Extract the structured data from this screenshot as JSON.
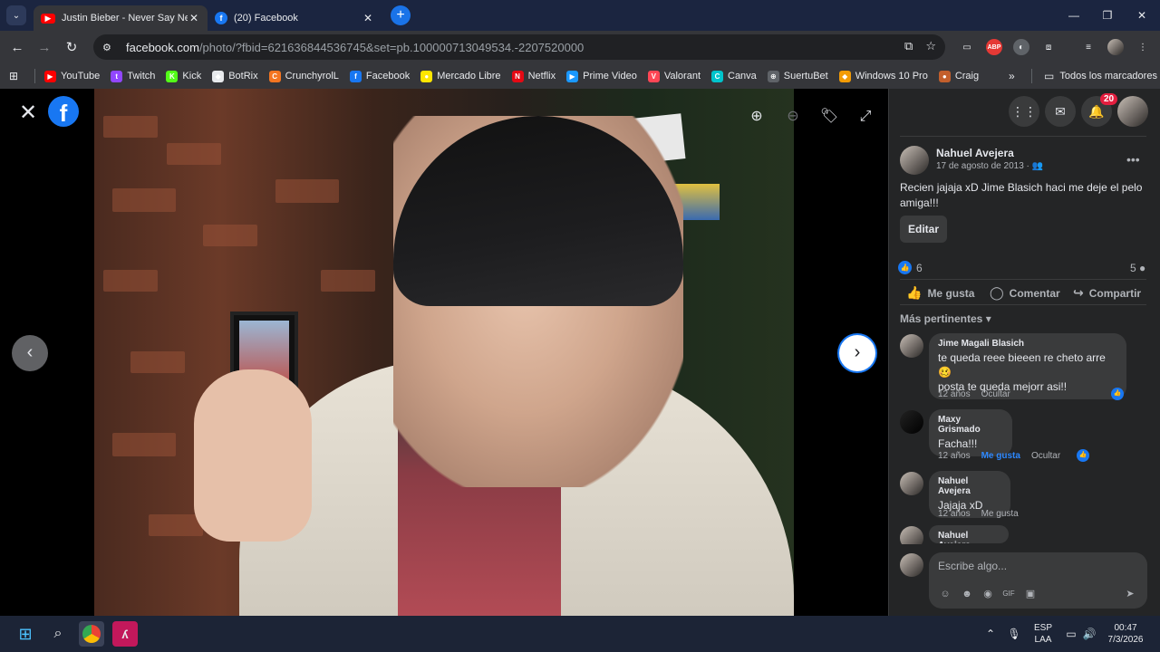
{
  "browser": {
    "tabs": [
      {
        "title": "Justin Bieber - Never Say Never",
        "icon": "youtube-icon",
        "active": true
      },
      {
        "title": "(20) Facebook",
        "icon": "facebook-icon",
        "active": false
      }
    ],
    "url_host": "facebook.com",
    "url_path": "/photo/?fbid=621636844536745&set=pb.100000713049534.-2207520000",
    "bookmarks": [
      {
        "label": "YouTube",
        "color": "#ff0000",
        "glyph": "▶"
      },
      {
        "label": "Twitch",
        "color": "#9146ff",
        "glyph": "t"
      },
      {
        "label": "Kick",
        "color": "#53fc18",
        "glyph": "K"
      },
      {
        "label": "BotRix",
        "color": "#e8eaed",
        "glyph": "◆"
      },
      {
        "label": "CrunchyrolL",
        "color": "#f47521",
        "glyph": "C"
      },
      {
        "label": "Facebook",
        "color": "#1877f2",
        "glyph": "f"
      },
      {
        "label": "Mercado Libre",
        "color": "#ffe600",
        "glyph": "●"
      },
      {
        "label": "Netflix",
        "color": "#e50914",
        "glyph": "N"
      },
      {
        "label": "Prime Video",
        "color": "#1a98ff",
        "glyph": "▶"
      },
      {
        "label": "Valorant",
        "color": "#ff4655",
        "glyph": "V"
      },
      {
        "label": "Canva",
        "color": "#00c4cc",
        "glyph": "C"
      },
      {
        "label": "SuertuBet",
        "color": "#5f6368",
        "glyph": "⊕"
      },
      {
        "label": "Windows 10 Pro",
        "color": "#f29b05",
        "glyph": "◆"
      },
      {
        "label": "Craig",
        "color": "#c35f2c",
        "glyph": "●"
      }
    ],
    "all_bookmarks": "Todos los marcadores"
  },
  "post": {
    "author": "Nahuel Avejera",
    "date": "17 de agosto de 2013 ·",
    "text": "Recien jajaja xD Jime Blasich haci me deje el pelo amiga!!!",
    "edit_label": "Editar",
    "reactions": "6",
    "comments_count": "5",
    "actions": {
      "like": "Me gusta",
      "comment": "Comentar",
      "share": "Compartir"
    },
    "sort_label": "Más pertinentes"
  },
  "notifications_badge": "20",
  "comments": [
    {
      "name": "Jime Magali Blasich",
      "text_line1": "te queda reee bieeen re cheto arre 🥴",
      "text_line2": "posta te queda mejorr asi!!",
      "time": "12 años",
      "actions": [
        "Ocultar"
      ]
    },
    {
      "name": "Maxy Grismado",
      "text_line1": "Facha!!!",
      "time": "12 años",
      "actions": [
        "Me gusta",
        "Ocultar"
      ]
    },
    {
      "name": "Nahuel Avejera",
      "text_line1": "Jajaja xD",
      "time": "12 años",
      "actions": [
        "Me gusta"
      ]
    },
    {
      "name": "Nahuel Avejera"
    }
  ],
  "composer": {
    "placeholder": "Escribe algo..."
  },
  "taskbar": {
    "lang_top": "ESP",
    "lang_bottom": "LAA",
    "time": "00:47",
    "date": "7/3/2026"
  }
}
